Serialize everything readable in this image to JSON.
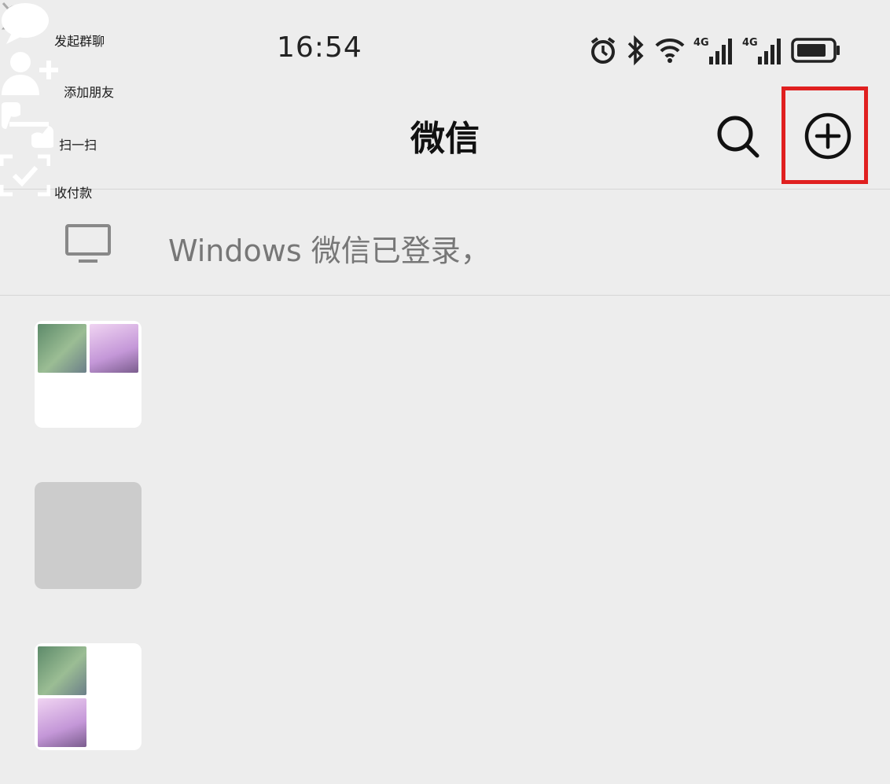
{
  "status_bar": {
    "time": "16:54",
    "icons": [
      "alarm-icon",
      "bluetooth-icon",
      "wifi-icon",
      "4g-signal-icon",
      "4g-signal-icon",
      "battery-icon"
    ],
    "network_labels": [
      "4G",
      "4G"
    ]
  },
  "header": {
    "title": "微信",
    "icons": [
      "search-icon",
      "plus-circle-icon"
    ]
  },
  "banner": {
    "text": "Windows 微信已登录，"
  },
  "chats": [
    {
      "avatar": "group-avatar-grid",
      "name": "redacted",
      "preview": "redacted"
    },
    {
      "avatar": "photo-avatar",
      "name": "redacted",
      "preview": "redacted"
    },
    {
      "avatar": "group-avatar-grid",
      "name": "redacted",
      "preview": "redacted",
      "muted": true
    }
  ],
  "menu": {
    "items": [
      {
        "label": "发起群聊",
        "icon": "chat-bubble-icon"
      },
      {
        "label": "添加朋友",
        "icon": "add-friend-icon"
      },
      {
        "label": "扫一扫",
        "icon": "scan-icon",
        "highlighted": true
      },
      {
        "label": "收付款",
        "icon": "payment-scan-icon"
      }
    ]
  },
  "colors": {
    "background": "#ededed",
    "menu_background": "#4c4c4c",
    "highlight": "#e02020"
  }
}
